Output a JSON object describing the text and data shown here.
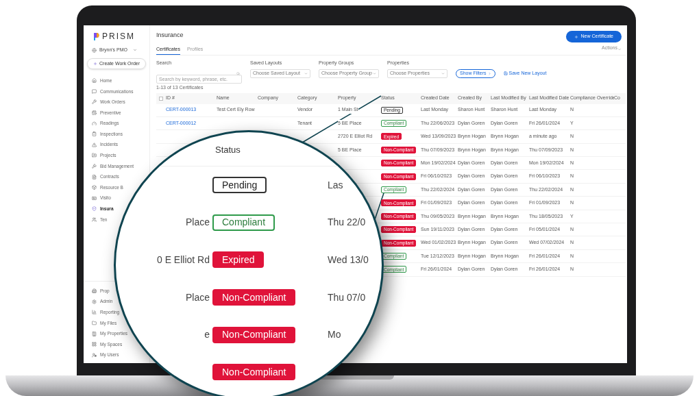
{
  "sidebar": {
    "logo": "PRISM",
    "account": "Brynn's PMO",
    "create_button": "Create Work Order",
    "items": [
      {
        "label": "Home",
        "selected": false
      },
      {
        "label": "Communications",
        "selected": false
      },
      {
        "label": "Work Orders",
        "selected": false
      },
      {
        "label": "Preventive",
        "selected": false
      },
      {
        "label": "Readings",
        "selected": false
      },
      {
        "label": "Inspections",
        "selected": false
      },
      {
        "label": "Incidents",
        "selected": false
      },
      {
        "label": "Projects",
        "selected": false
      },
      {
        "label": "Bid Management",
        "selected": false
      },
      {
        "label": "Contracts",
        "selected": false
      },
      {
        "label": "Resource B",
        "selected": false
      },
      {
        "label": "Visito",
        "selected": false
      },
      {
        "label": "Insura",
        "selected": true
      },
      {
        "label": "Ten",
        "selected": false
      }
    ],
    "bottom_items": [
      {
        "label": "Prop",
        "selected": false
      },
      {
        "label": "Admin",
        "selected": false
      },
      {
        "label": "Reporting",
        "selected": false
      },
      {
        "label": "My Files",
        "selected": false
      },
      {
        "label": "My Properties",
        "selected": false
      },
      {
        "label": "My Spaces",
        "selected": false
      },
      {
        "label": "My Users",
        "selected": false
      }
    ]
  },
  "page": {
    "title": "Insurance",
    "new_button": "New Certificate",
    "actions": "Actions",
    "tabs": [
      {
        "label": "Certificates",
        "selected": true
      },
      {
        "label": "Profiles",
        "selected": false
      }
    ]
  },
  "filters": {
    "search": {
      "label": "Search",
      "placeholder": "Search by keyword, phrase, etc."
    },
    "dropdowns": [
      {
        "label": "Saved Layouts",
        "value": "Choose Saved Layout"
      },
      {
        "label": "Property Groups",
        "value": "Choose Property Group"
      },
      {
        "label": "Properties",
        "value": "Choose Properties"
      }
    ],
    "show_filters": "Show Filters",
    "save_layout": "Save New Layout"
  },
  "table": {
    "count": "1-13 of 13 Certificates",
    "select_all": {
      "checked": false
    },
    "columns": [
      "ID #",
      "Name",
      "Company",
      "Category",
      "Property",
      "Status",
      "Created Date",
      "Created By",
      "Last Modified By",
      "Last Modified Date",
      "Compliance Override",
      "Co"
    ],
    "rows": [
      {
        "id": "CERT-000013",
        "name": "Test Cert Ely Row",
        "category": "Vendor",
        "property": "1 Main St",
        "status": "Pending",
        "kind": "pending",
        "created_date": "Last Monday",
        "created_by": "Sharon Hunt",
        "modified_by": "Sharon Hunt",
        "modified_date": "Last Monday",
        "override": "N"
      },
      {
        "id": "CERT-000012",
        "category": "Tenant",
        "property": "5 BE Place",
        "status": "Compliant",
        "kind": "compliant",
        "created_date": "Thu 22/06/2023",
        "created_by": "Dylan Goren",
        "modified_by": "Dylan Goren",
        "modified_date": "Fri 26/01/2024",
        "override": "Y"
      },
      {
        "property": "2720 E Elliot Rd",
        "status": "Expired",
        "kind": "expired",
        "created_date": "Wed 13/09/2023",
        "created_by": "Brynn Hogan",
        "modified_by": "Brynn Hogan",
        "modified_date": "a minute ago",
        "override": "N"
      },
      {
        "property": "5 BE Place",
        "status": "Non-Compliant",
        "kind": "noncompliant",
        "created_date": "Thu 07/09/2023",
        "created_by": "Brynn Hogan",
        "modified_by": "Brynn Hogan",
        "modified_date": "Thu 07/09/2023",
        "override": "N"
      },
      {
        "status": "Non-Compliant",
        "kind": "noncompliant",
        "created_date": "Mon 19/02/2024",
        "created_by": "Dylan Goren",
        "modified_by": "Dylan Goren",
        "modified_date": "Mon 19/02/2024",
        "override": "N"
      },
      {
        "status": "Non-Compliant",
        "kind": "noncompliant",
        "created_date": "Fri 06/10/2023",
        "created_by": "Dylan Goren",
        "modified_by": "Dylan Goren",
        "modified_date": "Fri 06/10/2023",
        "override": "N"
      },
      {
        "status": "Compliant",
        "kind": "compliant",
        "created_date": "Thu 22/02/2024",
        "created_by": "Dylan Goren",
        "modified_by": "Dylan Goren",
        "modified_date": "Thu 22/02/2024",
        "override": "N"
      },
      {
        "status": "Non-Compliant",
        "kind": "noncompliant",
        "created_date": "Fri 01/09/2023",
        "created_by": "Dylan Goren",
        "modified_by": "Dylan Goren",
        "modified_date": "Fri 01/09/2023",
        "override": "N"
      },
      {
        "status": "Non-Compliant",
        "kind": "noncompliant",
        "created_date": "Thu 09/05/2023",
        "created_by": "Brynn Hogan",
        "modified_by": "Brynn Hogan",
        "modified_date": "Thu 18/05/2023",
        "override": "Y"
      },
      {
        "status": "Non-Compliant",
        "kind": "noncompliant",
        "created_date": "Sun 19/11/2023",
        "created_by": "Dylan Goren",
        "modified_by": "Dylan Goren",
        "modified_date": "Fri 05/01/2024",
        "override": "N"
      },
      {
        "status": "Non-Compliant",
        "kind": "noncompliant",
        "created_date": "Wed 01/02/2023",
        "created_by": "Brynn Hogan",
        "modified_by": "Dylan Goren",
        "modified_date": "Wed 07/02/2024",
        "override": "N"
      },
      {
        "status": "Compliant",
        "kind": "compliant",
        "created_date": "Tue 12/12/2023",
        "created_by": "Brynn Hogan",
        "modified_by": "Brynn Hogan",
        "modified_date": "Fri 26/01/2024",
        "override": "N"
      },
      {
        "status": "Compliant",
        "kind": "compliant",
        "created_date": "Fri 26/01/2024",
        "created_by": "Dylan Goren",
        "modified_by": "Dylan Goren",
        "modified_date": "Fri 26/01/2024",
        "override": "N"
      }
    ]
  },
  "magnifier": {
    "heading": "Status",
    "rows": [
      {
        "status": "Pending",
        "kind": "pending",
        "date": "Las"
      },
      {
        "left": "Place",
        "status": "Compliant",
        "kind": "compliant",
        "date": "Thu 22/0"
      },
      {
        "left": "0 E Elliot Rd",
        "status": "Expired",
        "kind": "expired",
        "date": "Wed 13/0"
      },
      {
        "left": "Place",
        "status": "Non-Compliant",
        "kind": "noncompliant",
        "date": "Thu 07/0"
      },
      {
        "left": "e",
        "status": "Non-Compliant",
        "kind": "noncompliant",
        "date": "Mo"
      },
      {
        "status": "Non-Compliant",
        "kind": "noncompliant"
      }
    ]
  }
}
